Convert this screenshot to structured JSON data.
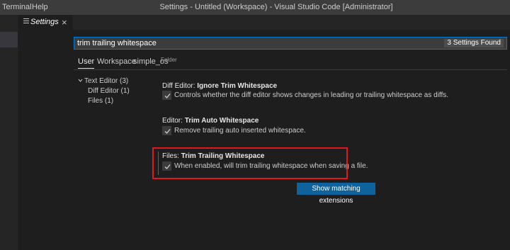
{
  "menu": {
    "terminal": "Terminal",
    "help": "Help"
  },
  "window": {
    "title": "Settings - Untitled (Workspace) - Visual Studio Code [Administrator]"
  },
  "tab": {
    "label": "Settings",
    "close": "×",
    "icon": "settings-editor-icon"
  },
  "search": {
    "value": "trim trailing whitespace",
    "count": "3 Settings Found"
  },
  "scopes": {
    "user": "User",
    "workspace": "Workspace",
    "folder_name": "simple_os",
    "folder_tag": "Folder"
  },
  "toc": {
    "text_editor": "Text Editor (3)",
    "diff_editor": "Diff Editor (1)",
    "files": "Files (1)"
  },
  "settings": [
    {
      "category": "Diff Editor: ",
      "name": "Ignore Trim Whitespace",
      "description": "Controls whether the diff editor shows changes in leading or trailing whitespace as diffs.",
      "checked": true
    },
    {
      "category": "Editor: ",
      "name": "Trim Auto Whitespace",
      "description": "Remove trailing auto inserted whitespace.",
      "checked": true
    },
    {
      "category": "Files: ",
      "name": "Trim Trailing Whitespace",
      "description": "When enabled, will trim trailing whitespace when saving a file.",
      "checked": true
    }
  ],
  "extensions_button": "Show matching extensions",
  "colors": {
    "background": "#1e1e1e",
    "titlebar": "#3c3c3c",
    "accent": "#007acc",
    "button": "#0e639c",
    "highlight_box": "#e0181d"
  }
}
